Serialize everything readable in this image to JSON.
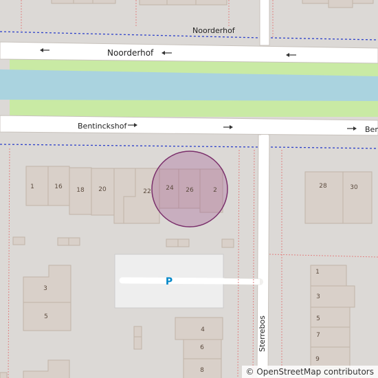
{
  "streets": {
    "north": "Noorderhof",
    "middle": "Bentinckshof",
    "middle_edge": "Ben",
    "vertical": "Sterrebos"
  },
  "house_numbers": [
    "1",
    "16",
    "18",
    "20",
    "22",
    "24",
    "26",
    "2",
    "28",
    "30",
    "3",
    "5",
    "4",
    "6",
    "8",
    "1",
    "3",
    "5",
    "7",
    "9"
  ],
  "parking_label": "P",
  "attribution": "© OpenStreetMap contributors",
  "colors": {
    "background": "#dcd9d6",
    "building": "#d9d0c9",
    "building_stroke": "#c1b4a8",
    "road": "#ffffff",
    "water": "#aad3df",
    "grass": "#c9eaa4",
    "parking": "#eeeeee",
    "boundary_blue": "#2b3fc9",
    "boundary_red": "#e08282",
    "highlight_fill": "#9b4c8a",
    "highlight_stroke": "#7a2f6b",
    "parking_symbol": "#0087c8"
  }
}
